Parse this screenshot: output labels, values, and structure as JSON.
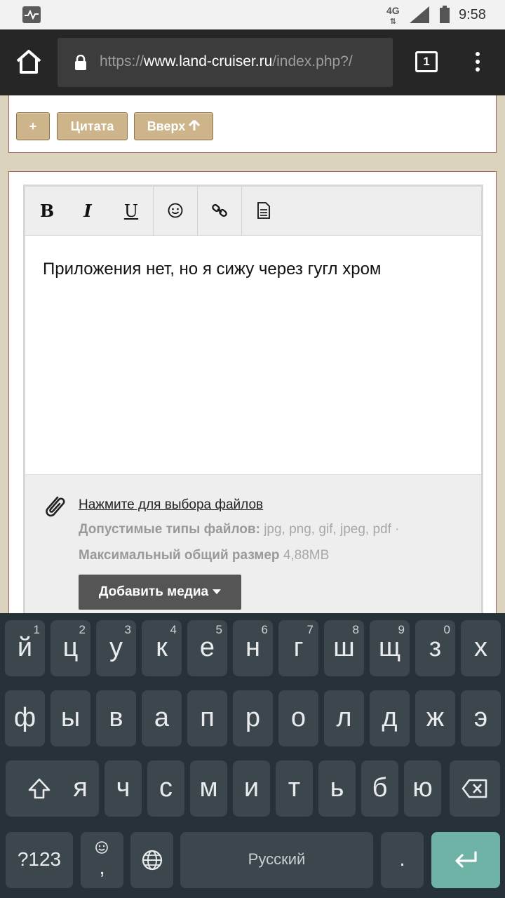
{
  "status_bar": {
    "network": "4G",
    "time": "9:58"
  },
  "browser": {
    "url_scheme": "https://",
    "url_host": "www.land-cruiser.ru",
    "url_path": "/index.php?/",
    "tab_count": "1"
  },
  "controls": {
    "plus_label": "+",
    "quote_label": "Цитата",
    "up_label": "Вверх"
  },
  "toolbar": {
    "bold": "B",
    "italic": "I",
    "underline": "U"
  },
  "editor": {
    "text": "Приложения нет, но я сижу через гугл хром"
  },
  "attachments": {
    "link": "Нажмите для выбора файлов",
    "types_label": "Допустимые типы файлов:",
    "types_value": "jpg, png, gif, jpeg, pdf ·",
    "max_label": "Максимальный общий размер",
    "max_value": "4,88MB",
    "add_media": "Добавить медиа"
  },
  "keyboard": {
    "row1": [
      {
        "ch": "й",
        "hint": "1"
      },
      {
        "ch": "ц",
        "hint": "2"
      },
      {
        "ch": "у",
        "hint": "3"
      },
      {
        "ch": "к",
        "hint": "4"
      },
      {
        "ch": "е",
        "hint": "5"
      },
      {
        "ch": "н",
        "hint": "6"
      },
      {
        "ch": "г",
        "hint": "7"
      },
      {
        "ch": "ш",
        "hint": "8"
      },
      {
        "ch": "щ",
        "hint": "9"
      },
      {
        "ch": "з",
        "hint": "0"
      },
      {
        "ch": "х",
        "hint": ""
      }
    ],
    "row2": [
      "ф",
      "ы",
      "в",
      "а",
      "п",
      "р",
      "о",
      "л",
      "д",
      "ж",
      "э"
    ],
    "row3": [
      "я",
      "ч",
      "с",
      "м",
      "и",
      "т",
      "ь",
      "б",
      "ю"
    ],
    "symbols_label": "?123",
    "comma": ",",
    "space_label": "Русский",
    "period": "."
  },
  "colors": {
    "page_bg": "#dcd3bf",
    "button_tan": "#cdb48a",
    "keyboard_bg": "#263238",
    "key_bg": "#3c474d",
    "enter_key": "#6fb3a7"
  }
}
